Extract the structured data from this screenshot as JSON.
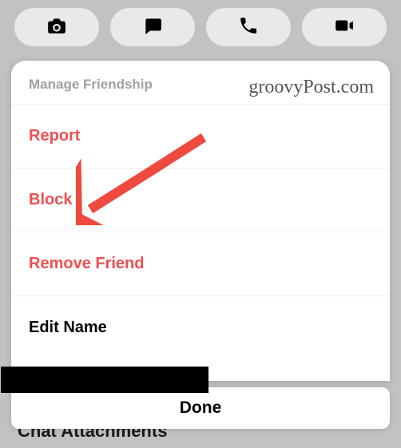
{
  "toolbar": {
    "camera": "camera",
    "chat": "chat",
    "call": "call",
    "video": "video"
  },
  "sheet": {
    "header": "Manage Friendship",
    "items": [
      {
        "label": "Report",
        "style": "destructive"
      },
      {
        "label": "Block",
        "style": "destructive"
      },
      {
        "label": "Remove Friend",
        "style": "destructive"
      },
      {
        "label": "Edit Name",
        "style": "normal"
      }
    ]
  },
  "done_label": "Done",
  "background_hint": "Chat Attachments",
  "watermark": "groovyPost.com",
  "annotation": {
    "arrow_target": "Block",
    "arrow_color": "#ee4a3f"
  }
}
